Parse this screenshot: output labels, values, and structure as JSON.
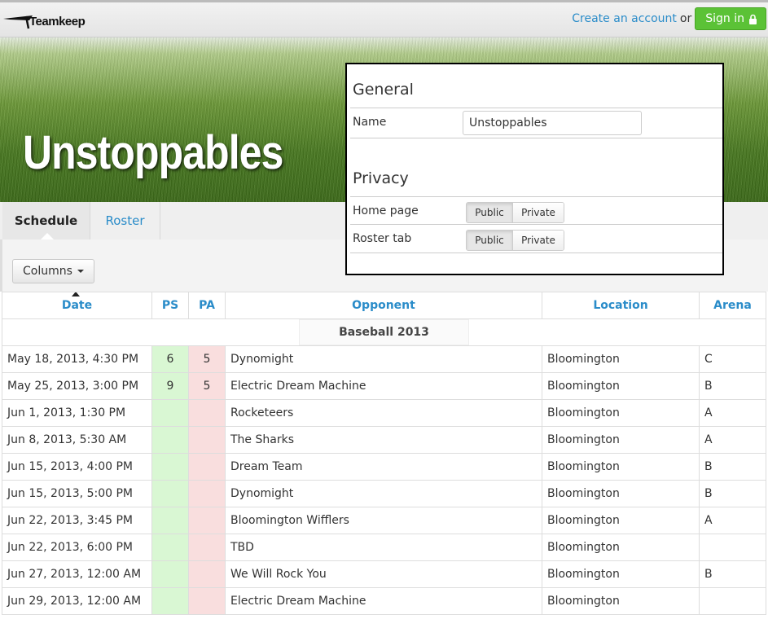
{
  "header": {
    "logo_text": "Teamkeep",
    "create_account": "Create an account",
    "or": "or",
    "sign_in": "Sign in"
  },
  "team": {
    "name": "Unstoppables"
  },
  "tabs": [
    {
      "label": "Schedule",
      "active": true
    },
    {
      "label": "Roster",
      "active": false
    }
  ],
  "toolbar": {
    "columns_label": "Columns"
  },
  "table": {
    "headers": [
      "Date",
      "PS",
      "PA",
      "Opponent",
      "Location",
      "Arena"
    ],
    "group": "Baseball 2013",
    "rows": [
      {
        "date": "May 18, 2013, 4:30 PM",
        "ps": "6",
        "pa": "5",
        "opponent": "Dynomight",
        "location": "Bloomington",
        "arena": "C"
      },
      {
        "date": "May 25, 2013, 3:00 PM",
        "ps": "9",
        "pa": "5",
        "opponent": "Electric Dream Machine",
        "location": "Bloomington",
        "arena": "B"
      },
      {
        "date": "Jun 1, 2013, 1:30 PM",
        "ps": "",
        "pa": "",
        "opponent": "Rocketeers",
        "location": "Bloomington",
        "arena": "A"
      },
      {
        "date": "Jun 8, 2013, 5:30 AM",
        "ps": "",
        "pa": "",
        "opponent": "The Sharks",
        "location": "Bloomington",
        "arena": "A"
      },
      {
        "date": "Jun 15, 2013, 4:00 PM",
        "ps": "",
        "pa": "",
        "opponent": "Dream Team",
        "location": "Bloomington",
        "arena": "B"
      },
      {
        "date": "Jun 15, 2013, 5:00 PM",
        "ps": "",
        "pa": "",
        "opponent": "Dynomight",
        "location": "Bloomington",
        "arena": "B"
      },
      {
        "date": "Jun 22, 2013, 3:45 PM",
        "ps": "",
        "pa": "",
        "opponent": "Bloomington Wifflers",
        "location": "Bloomington",
        "arena": "A"
      },
      {
        "date": "Jun 22, 2013, 6:00 PM",
        "ps": "",
        "pa": "",
        "opponent": "TBD",
        "location": "Bloomington",
        "arena": ""
      },
      {
        "date": "Jun 27, 2013, 12:00 AM",
        "ps": "",
        "pa": "",
        "opponent": "We Will Rock You",
        "location": "Bloomington",
        "arena": "B"
      },
      {
        "date": "Jun 29, 2013, 12:00 AM",
        "ps": "",
        "pa": "",
        "opponent": "Electric Dream Machine",
        "location": "Bloomington",
        "arena": ""
      }
    ]
  },
  "settings": {
    "general_heading": "General",
    "name_label": "Name",
    "name_value": "Unstoppables",
    "privacy_heading": "Privacy",
    "home_page_label": "Home page",
    "roster_tab_label": "Roster tab",
    "public_label": "Public",
    "private_label": "Private"
  }
}
